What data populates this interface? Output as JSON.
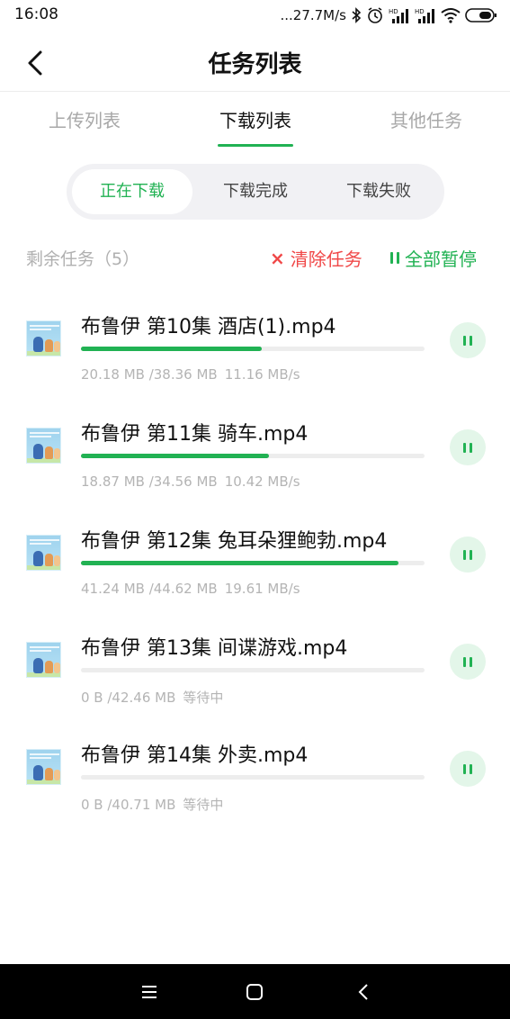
{
  "status_bar": {
    "time": "16:08",
    "network_speed": "...27.7M/s",
    "icons": [
      "bluetooth-icon",
      "alarm-icon",
      "hd-signal-icon",
      "hd-signal-icon",
      "wifi-icon",
      "battery-icon"
    ]
  },
  "header": {
    "title": "任务列表",
    "back_icon": "chevron-left-icon"
  },
  "tabs": [
    {
      "label": "上传列表",
      "active": false
    },
    {
      "label": "下载列表",
      "active": true
    },
    {
      "label": "其他任务",
      "active": false
    }
  ],
  "segments": [
    {
      "label": "正在下载",
      "active": true
    },
    {
      "label": "下载完成",
      "active": false
    },
    {
      "label": "下载失败",
      "active": false
    }
  ],
  "summary": {
    "remaining_label": "剩余任务（5）",
    "clear_label": "清除任务",
    "clear_icon": "×",
    "pause_all_label": "全部暂停"
  },
  "downloads": [
    {
      "name": "布鲁伊 第10集 酒店(1).mp4",
      "size": "20.18 MB /38.36 MB",
      "status": "11.16 MB/s",
      "progress": 0.526
    },
    {
      "name": "布鲁伊 第11集 骑车.mp4",
      "size": "18.87 MB /34.56 MB",
      "status": "10.42 MB/s",
      "progress": 0.546
    },
    {
      "name": "布鲁伊 第12集 兔耳朵狸鲍勃.mp4",
      "size": "41.24 MB /44.62 MB",
      "status": "19.61 MB/s",
      "progress": 0.924
    },
    {
      "name": "布鲁伊 第13集 间谍游戏.mp4",
      "size": "0 B /42.46 MB",
      "status": "等待中",
      "progress": 0
    },
    {
      "name": "布鲁伊 第14集 外卖.mp4",
      "size": "0 B /40.71 MB",
      "status": "等待中",
      "progress": 0
    }
  ],
  "colors": {
    "accent": "#21b253",
    "danger": "#f04848",
    "track": "#ededed"
  },
  "nav_bar": {
    "buttons": [
      "menu-icon",
      "home-square-icon",
      "back-triangle-icon"
    ]
  }
}
